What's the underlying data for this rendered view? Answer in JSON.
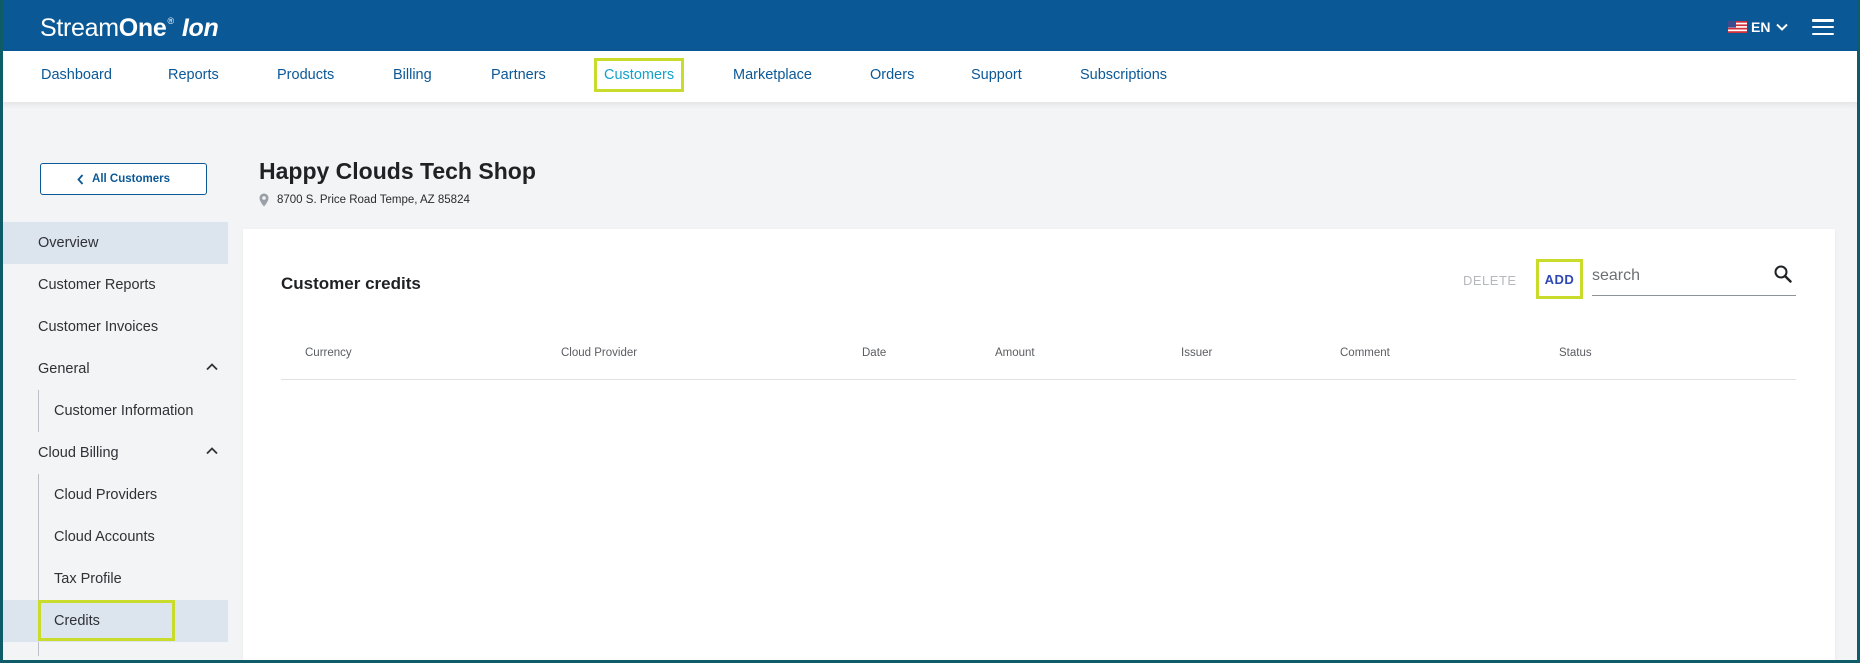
{
  "brand": {
    "stream": "Stream",
    "one": "One",
    "reg": "®",
    "ion": "Ion"
  },
  "language": {
    "code": "EN"
  },
  "nav": [
    {
      "label": "Dashboard"
    },
    {
      "label": "Reports"
    },
    {
      "label": "Products"
    },
    {
      "label": "Billing"
    },
    {
      "label": "Partners"
    },
    {
      "label": "Customers",
      "active": true
    },
    {
      "label": "Marketplace"
    },
    {
      "label": "Orders"
    },
    {
      "label": "Support"
    },
    {
      "label": "Subscriptions"
    }
  ],
  "back_button": {
    "label": "All Customers"
  },
  "sidebar": {
    "overview": "Overview",
    "customer_reports": "Customer Reports",
    "customer_invoices": "Customer Invoices",
    "general": {
      "label": "General",
      "items": [
        "Customer Information"
      ]
    },
    "cloud_billing": {
      "label": "Cloud Billing",
      "items": [
        "Cloud Providers",
        "Cloud Accounts",
        "Tax Profile",
        "Credits"
      ]
    }
  },
  "customer": {
    "name": "Happy Clouds Tech Shop",
    "address": "8700 S. Price Road Tempe, AZ 85824"
  },
  "credits_panel": {
    "title": "Customer credits",
    "delete_label": "DELETE",
    "add_label": "ADD",
    "search_placeholder": "search",
    "search_value": "",
    "columns": [
      "Currency",
      "Cloud Provider",
      "Date",
      "Amount",
      "Issuer",
      "Comment",
      "Status"
    ],
    "rows": []
  },
  "colors": {
    "header_bg": "#0b5896",
    "nav_text": "#0b5896",
    "nav_active": "#14a1cc",
    "highlight": "#c9dc2b",
    "add_text": "#2e48b3",
    "selected_bg": "#dce5ee"
  }
}
